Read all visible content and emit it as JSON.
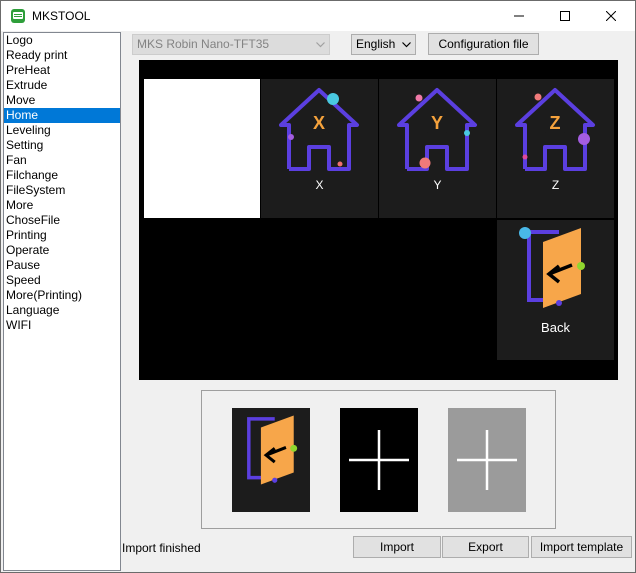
{
  "window": {
    "title": "MKSTOOL"
  },
  "sidebar": {
    "items": [
      "Logo",
      "Ready print",
      "PreHeat",
      "Extrude",
      "Move",
      "Home",
      "Leveling",
      "Setting",
      "Fan",
      "Filchange",
      "FileSystem",
      "More",
      "ChoseFile",
      "Printing",
      "Operate",
      "Pause",
      "Speed",
      "More(Printing)",
      "Language",
      "WIFI"
    ],
    "selected": "Home"
  },
  "toolbar": {
    "device_value": "MKS Robin Nano-TFT35",
    "language_value": "English",
    "config_label": "Configuration file"
  },
  "preview": {
    "buttons": [
      {
        "letter": "X",
        "label": "X"
      },
      {
        "letter": "Y",
        "label": "Y"
      },
      {
        "letter": "Z",
        "label": "Z"
      }
    ],
    "back_label": "Back"
  },
  "bottom": {
    "status": "Import finished",
    "import_label": "Import",
    "export_label": "Export",
    "template_label": "Import template"
  },
  "colors": {
    "accent": "#0078d7",
    "house_stroke": "#5b3fe0",
    "house_letter": "#f5a23c",
    "back_fill": "#f7a64a"
  }
}
